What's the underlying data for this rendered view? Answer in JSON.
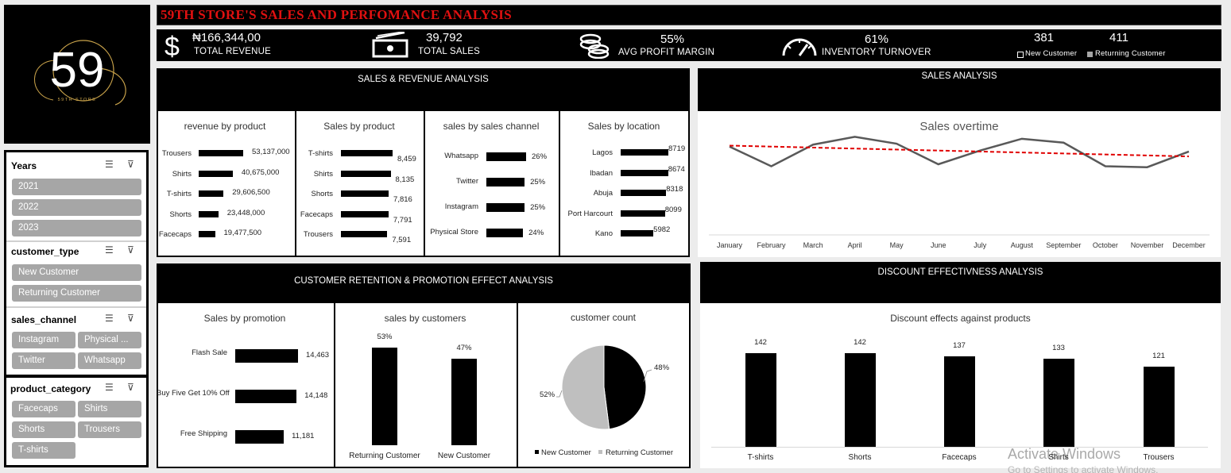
{
  "title": "59TH STORE'S SALES AND PERFOMANCE ANALYSIS",
  "logo": {
    "number": "59",
    "subtitle": "59TH STORE"
  },
  "kpis": {
    "revenue": {
      "value": "₦166,344,00",
      "label": "TOTAL REVENUE",
      "icon": "dollar-icon"
    },
    "sales": {
      "value": "39,792",
      "label": "TOTAL SALES",
      "icon": "cash-icon"
    },
    "margin": {
      "value": "55%",
      "label": "AVG PROFIT MARGIN",
      "icon": "coins-icon"
    },
    "turnover": {
      "value": "61%",
      "label": "INVENTORY TURNOVER",
      "icon": "gauge-icon"
    },
    "new_customer": {
      "value": "381",
      "label": "New Customer"
    },
    "returning_customer": {
      "value": "411",
      "label": "Returning Customer"
    }
  },
  "slicers": {
    "years": {
      "title": "Years",
      "items": [
        "2021",
        "2022",
        "2023"
      ]
    },
    "customer_type": {
      "title": "customer_type",
      "items": [
        "New Customer",
        "Returning Customer"
      ]
    },
    "sales_channel": {
      "title": "sales_channel",
      "items": [
        "Instagram",
        "Physical ...",
        "Twitter",
        "Whatsapp"
      ]
    },
    "product_category": {
      "title": "product_category",
      "items": [
        "Facecaps",
        "Shirts",
        "Shorts",
        "Trousers",
        "T-shirts"
      ]
    }
  },
  "sections": {
    "sales_revenue": "SALES & REVENUE ANALYSIS",
    "sales_analysis": "SALES ANALYSIS",
    "retention": "CUSTOMER RETENTION & PROMOTION EFFECT ANALYSIS",
    "discount": "DISCOUNT EFFECTIVNESS ANALYSIS"
  },
  "chart_data": [
    {
      "id": "revenue_by_product",
      "type": "bar",
      "orientation": "horizontal",
      "title": "revenue by product",
      "categories": [
        "Trousers",
        "Shirts",
        "T-shirts",
        "Shorts",
        "Facecaps"
      ],
      "values": [
        53137000,
        40675000,
        29606500,
        23448000,
        19477500
      ],
      "data_labels": [
        "53,137,000",
        "40,675,000",
        "29,606,500",
        "23,448,000",
        "19,477,500"
      ]
    },
    {
      "id": "sales_by_product",
      "type": "bar",
      "orientation": "horizontal",
      "title": "Sales by product",
      "categories": [
        "T-shirts",
        "Shirts",
        "Shorts",
        "Facecaps",
        "Trousers"
      ],
      "values": [
        8459,
        8135,
        7816,
        7791,
        7591
      ],
      "data_labels": [
        "8,459",
        "8,135",
        "7,816",
        "7,791",
        "7,591"
      ]
    },
    {
      "id": "sales_by_channel",
      "type": "bar",
      "orientation": "horizontal",
      "title": "sales by sales channel",
      "categories": [
        "Whatsapp",
        "Twitter",
        "Instagram",
        "Physical Store"
      ],
      "values": [
        26,
        25,
        25,
        24
      ],
      "data_labels": [
        "26%",
        "25%",
        "25%",
        "24%"
      ]
    },
    {
      "id": "sales_by_location",
      "type": "bar",
      "orientation": "horizontal",
      "title": "Sales by location",
      "categories": [
        "Lagos",
        "Ibadan",
        "Abuja",
        "Port Harcourt",
        "Kano"
      ],
      "values": [
        8719,
        8674,
        8318,
        8099,
        5982
      ],
      "data_labels": [
        "8719",
        "8674",
        "8318",
        "8099",
        "5982"
      ]
    },
    {
      "id": "sales_overtime",
      "type": "line",
      "title": "Sales overtime",
      "x": [
        "January",
        "February",
        "March",
        "April",
        "May",
        "June",
        "July",
        "August",
        "September",
        "October",
        "November",
        "December"
      ],
      "series": [
        {
          "values": [
            3400,
            3200,
            3420,
            3500,
            3430,
            3220,
            3360,
            3480,
            3440,
            3200,
            3190,
            3350
          ],
          "color": "#595959"
        }
      ],
      "trendline": {
        "start": 3410,
        "end": 3300,
        "color": "#e00000",
        "style": "dashed"
      },
      "ylim": [
        2500,
        3600
      ]
    },
    {
      "id": "sales_by_promotion",
      "type": "bar",
      "orientation": "horizontal",
      "title": "Sales by promotion",
      "categories": [
        "Flash Sale",
        "Buy Five Get 10% Off",
        "Free Shipping"
      ],
      "values": [
        14463,
        14148,
        11181
      ],
      "data_labels": [
        "14,463",
        "14,148",
        "11,181"
      ]
    },
    {
      "id": "sales_by_customers",
      "type": "bar",
      "title": "sales by customers",
      "categories": [
        "Returning Customer",
        "New Customer"
      ],
      "values": [
        53,
        47
      ],
      "data_labels": [
        "53%",
        "47%"
      ]
    },
    {
      "id": "customer_count",
      "type": "pie",
      "title": "customer count",
      "categories": [
        "New Customer",
        "Returning Customer"
      ],
      "values": [
        48,
        52
      ],
      "data_labels": [
        "48%",
        "52%"
      ],
      "colors": [
        "#000000",
        "#bfbfbf"
      ],
      "legend": "bottom"
    },
    {
      "id": "discount_effects",
      "type": "bar",
      "title": "Discount effects against products",
      "categories": [
        "T-shirts",
        "Shorts",
        "Facecaps",
        "Shirts",
        "Trousers"
      ],
      "values": [
        142,
        142,
        137,
        133,
        121
      ],
      "data_labels": [
        "142",
        "142",
        "137",
        "133",
        "121"
      ]
    }
  ],
  "watermark": {
    "line1": "Activate Windows",
    "line2": "Go to Settings to activate Windows."
  }
}
